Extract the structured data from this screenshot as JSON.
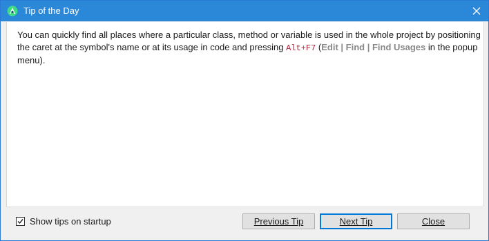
{
  "window": {
    "title": "Tip of the Day",
    "icon": "android-studio-icon",
    "titlebar_color": "#2b88d8"
  },
  "tip": {
    "text_before": "You can quickly find all places where a particular class, method or variable is used in the whole project by positioning the caret at the symbol's name or at its usage in code and pressing ",
    "shortcut": "Alt+F7",
    "text_paren_open": " (",
    "menu_path": "Edit | Find | Find Usages",
    "text_after": " in the popup menu).",
    "shortcut_color": "#b0243a"
  },
  "footer": {
    "show_tips_label": "Show tips on startup",
    "show_tips_checked": true,
    "previous_label": "Previous Tip",
    "next_label": "Next Tip",
    "close_label": "Close"
  }
}
